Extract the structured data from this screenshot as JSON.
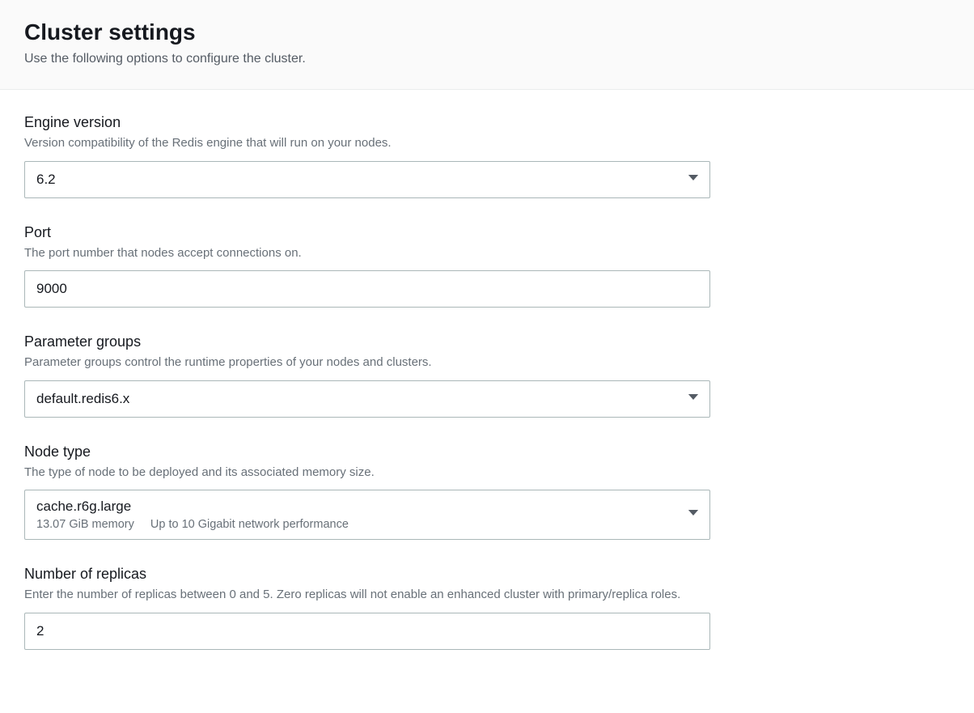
{
  "header": {
    "title": "Cluster settings",
    "description": "Use the following options to configure the cluster."
  },
  "fields": {
    "engine_version": {
      "label": "Engine version",
      "hint": "Version compatibility of the Redis engine that will run on your nodes.",
      "value": "6.2"
    },
    "port": {
      "label": "Port",
      "hint": "The port number that nodes accept connections on.",
      "value": "9000"
    },
    "parameter_groups": {
      "label": "Parameter groups",
      "hint": "Parameter groups control the runtime properties of your nodes and clusters.",
      "value": "default.redis6.x"
    },
    "node_type": {
      "label": "Node type",
      "hint": "The type of node to be deployed and its associated memory size.",
      "value": "cache.r6g.large",
      "sub_memory": "13.07 GiB memory",
      "sub_network": "Up to 10 Gigabit network performance"
    },
    "number_of_replicas": {
      "label": "Number of replicas",
      "hint": "Enter the number of replicas between 0 and 5. Zero replicas will not enable an enhanced cluster with primary/replica roles.",
      "value": "2"
    }
  }
}
